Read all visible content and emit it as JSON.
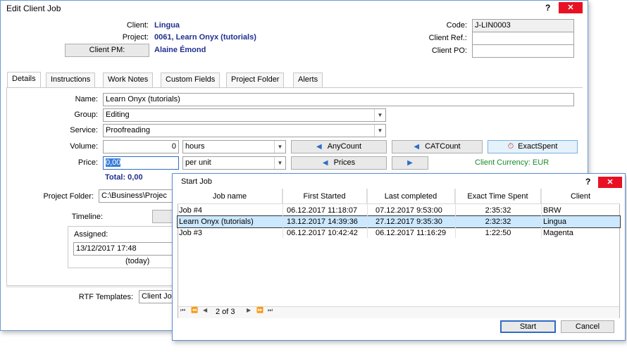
{
  "edit_window": {
    "title": "Edit Client Job",
    "help": "?",
    "close": "✕",
    "client_label": "Client:",
    "client_value": "Lingua",
    "project_label": "Project:",
    "project_value": "0061, Learn Onyx (tutorials)",
    "client_pm_button": "Client PM:",
    "client_pm_value": "Alaine Émond",
    "code_label": "Code:",
    "code_value": "J-LIN0003",
    "client_ref_label": "Client Ref.:",
    "client_ref_value": "",
    "client_po_label": "Client PO:",
    "client_po_value": "",
    "tabs": [
      "Details",
      "Instructions",
      "Work Notes",
      "Custom Fields",
      "Project Folder",
      "Alerts"
    ],
    "name_label": "Name:",
    "name_value": "Learn Onyx (tutorials)",
    "group_label": "Group:",
    "group_value": "Editing",
    "service_label": "Service:",
    "service_value": "Proofreading",
    "volume_label": "Volume:",
    "volume_value": "0",
    "volume_unit": "hours",
    "anycount_button": "AnyCount",
    "catcount_button": "CATCount",
    "exactspent_button": "ExactSpent",
    "price_label": "Price:",
    "price_value": "0,00",
    "price_unit": "per unit",
    "prices_button": "Prices",
    "client_currency": "Client Currency: EUR",
    "total": "Total: 0,00",
    "project_folder_label": "Project Folder:",
    "project_folder_value": "C:\\Business\\Projec",
    "timeline_label": "Timeline:",
    "assigned_label": "Assigned:",
    "assigned_value": "13/12/2017 17:48",
    "today": "(today)",
    "rtf_label": "RTF Templates:",
    "rtf_value": "Client Jo"
  },
  "start_job": {
    "title": "Start Job",
    "help": "?",
    "close": "✕",
    "columns": [
      "Job name",
      "First Started",
      "Last completed",
      "Exact Time Spent",
      "Client"
    ],
    "rows": [
      {
        "job": "Job #4",
        "first": "06.12.2017 11:18:07",
        "last": "07.12.2017 9:53:00",
        "spent": "2:35:32",
        "client": "BRW"
      },
      {
        "job": "Learn Onyx (tutorials)",
        "first": "13.12.2017 14:39:36",
        "last": "27.12.2017 9:35:30",
        "spent": "2:32:32",
        "client": "Lingua"
      },
      {
        "job": "Job #3",
        "first": "06.12.2017 10:42:42",
        "last": "06.12.2017 11:16:29",
        "spent": "1:22:50",
        "client": "Magenta"
      }
    ],
    "pager": "2 of 3",
    "start_button": "Start",
    "cancel_button": "Cancel"
  },
  "colors": {
    "accent": "#2f6cc8",
    "value_text": "#1f2f8f",
    "currency_text": "#1a8a2a",
    "selected_row": "#cce8ff",
    "close_red": "#e81123"
  },
  "icons": [
    "triangle-left-icon",
    "triangle-right-icon",
    "exactspent-icon",
    "chevron-down-icon",
    "close-icon",
    "pager-icons"
  ]
}
